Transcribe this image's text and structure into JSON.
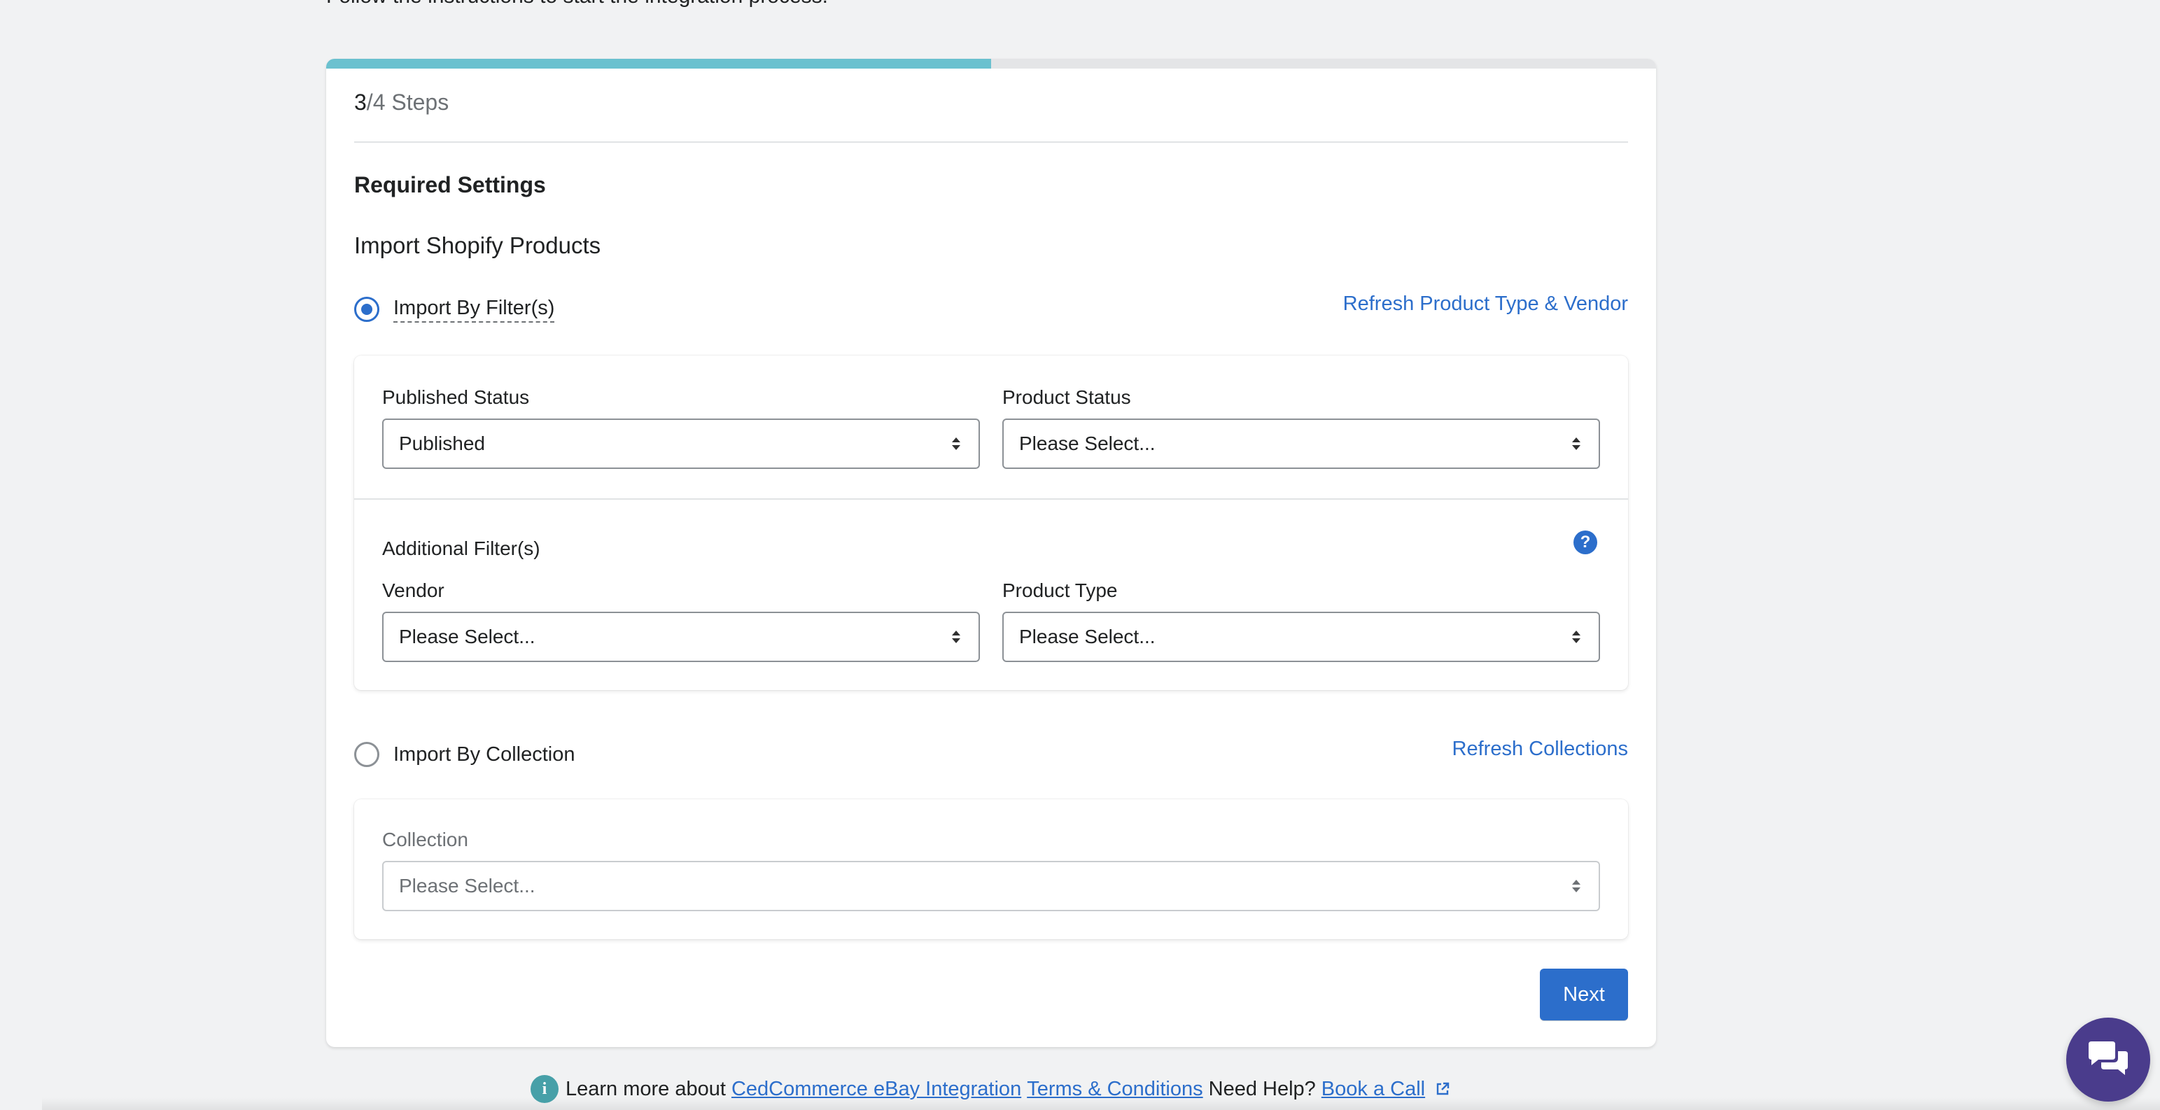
{
  "intro_text": "Follow the instructions to start the integration process.",
  "progress": {
    "current_step": "3",
    "step_suffix": "/4 Steps",
    "fraction": 0.5
  },
  "section_title": "Required Settings",
  "subsection_title": "Import Shopify Products",
  "import_by_filter": {
    "label": "Import By Filter(s)",
    "selected": true,
    "refresh_link": "Refresh Product Type & Vendor",
    "published_status": {
      "label": "Published Status",
      "value": "Published"
    },
    "product_status": {
      "label": "Product Status",
      "value": "Please Select..."
    },
    "additional_filters_label": "Additional Filter(s)",
    "vendor": {
      "label": "Vendor",
      "value": "Please Select..."
    },
    "product_type": {
      "label": "Product Type",
      "value": "Please Select..."
    }
  },
  "import_by_collection": {
    "label": "Import By Collection",
    "selected": false,
    "refresh_link": "Refresh Collections",
    "collection": {
      "label": "Collection",
      "value": "Please Select..."
    }
  },
  "next_button": "Next",
  "footer": {
    "learn_more": "Learn more about",
    "integration_link": "CedCommerce eBay Integration",
    "terms_link": "Terms & Conditions",
    "need_help": "Need Help?",
    "book_call_link": "Book a Call"
  },
  "icons": {
    "help": "question-circle-icon",
    "info": "info-circle-icon",
    "external": "external-link-icon",
    "chat": "chat-bubbles-icon"
  },
  "colors": {
    "accent": "#2c6ecb",
    "progress": "#6bc1cf",
    "chat": "#4a3c8c",
    "background": "#f1f2f3"
  }
}
